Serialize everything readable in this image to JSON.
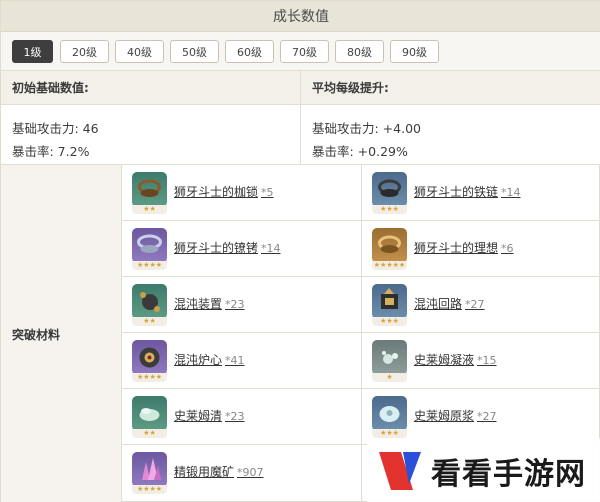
{
  "header": {
    "title": "成长数值"
  },
  "levels": {
    "buttons": [
      "1级",
      "20级",
      "40级",
      "50级",
      "60级",
      "70级",
      "80级",
      "90级"
    ],
    "selected": "1级"
  },
  "stats": {
    "base_heading": "初始基础数值:",
    "growth_heading": "平均每级提升:",
    "base": {
      "attack": "基础攻击力: 46",
      "crit": "暴击率: 7.2%"
    },
    "growth": {
      "attack": "基础攻击力: +4.00",
      "crit": "暴击率: +0.29%"
    }
  },
  "materials": {
    "label": "突破材料",
    "items": [
      {
        "name": "狮牙斗士的枷锁",
        "count": "*5",
        "icon": "shackle-icon",
        "rarity_color": "green"
      },
      {
        "name": "狮牙斗士的铁链",
        "count": "*14",
        "icon": "chain-icon",
        "rarity_color": "blue"
      },
      {
        "name": "狮牙斗士的镣铐",
        "count": "*14",
        "icon": "fetters-icon",
        "rarity_color": "purple"
      },
      {
        "name": "狮牙斗士的理想",
        "count": "*6",
        "icon": "ideal-icon",
        "rarity_color": "gold"
      },
      {
        "name": "混沌装置",
        "count": "*23",
        "icon": "chaos-device-icon",
        "rarity_color": "green"
      },
      {
        "name": "混沌回路",
        "count": "*27",
        "icon": "chaos-circuit-icon",
        "rarity_color": "blue"
      },
      {
        "name": "混沌炉心",
        "count": "*41",
        "icon": "chaos-core-icon",
        "rarity_color": "purple"
      },
      {
        "name": "史莱姆凝液",
        "count": "*15",
        "icon": "slime-condensate-icon",
        "rarity_color": "green"
      },
      {
        "name": "史莱姆清",
        "count": "*23",
        "icon": "slime-secretions-icon",
        "rarity_color": "green"
      },
      {
        "name": "史莱姆原浆",
        "count": "*27",
        "icon": "slime-concentrate-icon",
        "rarity_color": "blue"
      },
      {
        "name": "精锻用魔矿",
        "count": "*907",
        "icon": "mystic-ore-icon",
        "rarity_color": "purple"
      }
    ]
  },
  "colors": {
    "green": "#4f8d78",
    "blue": "#5d7e9f",
    "purple": "#7f6ab2",
    "gold": "#b3803f",
    "selected_button": "#3e3e3e"
  },
  "watermark": {
    "text": "看看手游网"
  }
}
